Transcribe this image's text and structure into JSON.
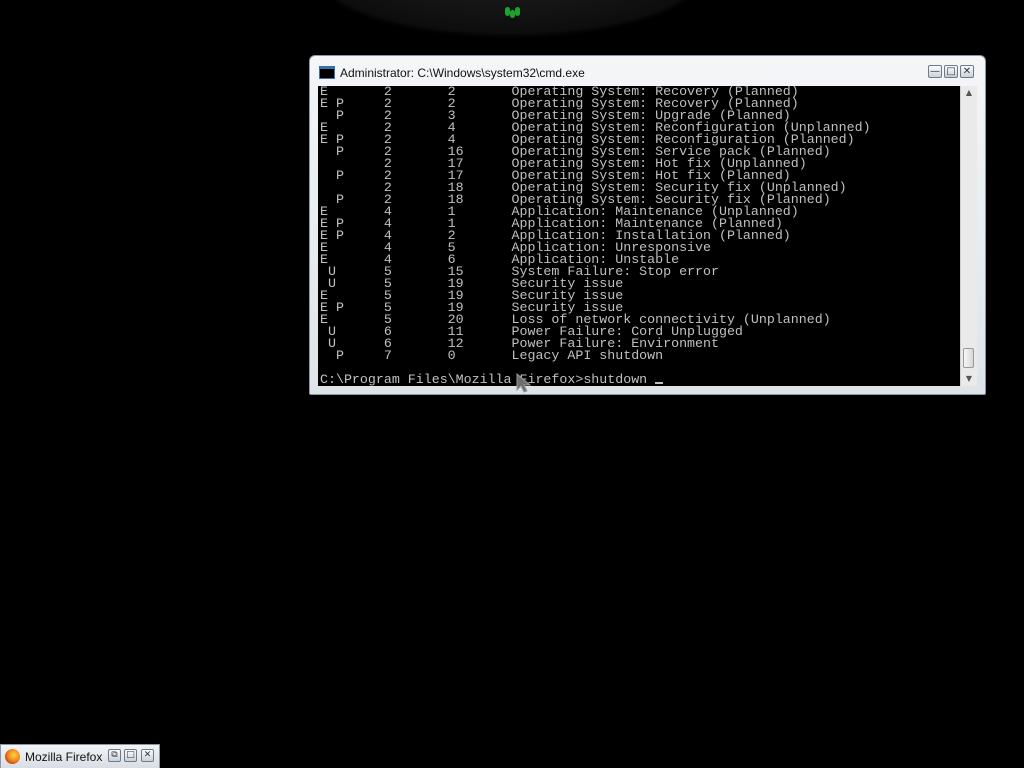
{
  "cmd_window": {
    "title": "Administrator: C:\\Windows\\system32\\cmd.exe",
    "buttons": {
      "minimize_glyph": "—",
      "maximize_glyph": "□",
      "close_glyph": "✕"
    },
    "console_lines": [
      "E       2       2       Operating System: Recovery (Planned)",
      "E P     2       2       Operating System: Recovery (Planned)",
      "  P     2       3       Operating System: Upgrade (Planned)",
      "E       2       4       Operating System: Reconfiguration (Unplanned)",
      "E P     2       4       Operating System: Reconfiguration (Planned)",
      "  P     2       16      Operating System: Service pack (Planned)",
      "        2       17      Operating System: Hot fix (Unplanned)",
      "  P     2       17      Operating System: Hot fix (Planned)",
      "        2       18      Operating System: Security fix (Unplanned)",
      "  P     2       18      Operating System: Security fix (Planned)",
      "E       4       1       Application: Maintenance (Unplanned)",
      "E P     4       1       Application: Maintenance (Planned)",
      "E P     4       2       Application: Installation (Planned)",
      "E       4       5       Application: Unresponsive",
      "E       4       6       Application: Unstable",
      " U      5       15      System Failure: Stop error",
      " U      5       19      Security issue",
      "E       5       19      Security issue",
      "E P     5       19      Security issue",
      "E       5       20      Loss of network connectivity (Unplanned)",
      " U      6       11      Power Failure: Cord Unplugged",
      " U      6       12      Power Failure: Environment",
      "  P     7       0       Legacy API shutdown"
    ],
    "prompt": "C:\\Program Files\\Mozilla Firefox>shutdown",
    "scrollbar": {
      "up_glyph": "▲",
      "down_glyph": "▼"
    }
  },
  "minimized_window": {
    "title": "Mozilla Firefox",
    "icon": "firefox-icon",
    "restore_glyph": "⧉",
    "maximize_glyph": "□",
    "close_glyph": "✕"
  },
  "colors": {
    "desktop": "#000000",
    "console_text": "#c0c0c0",
    "orb_green": "#1fa22b"
  }
}
